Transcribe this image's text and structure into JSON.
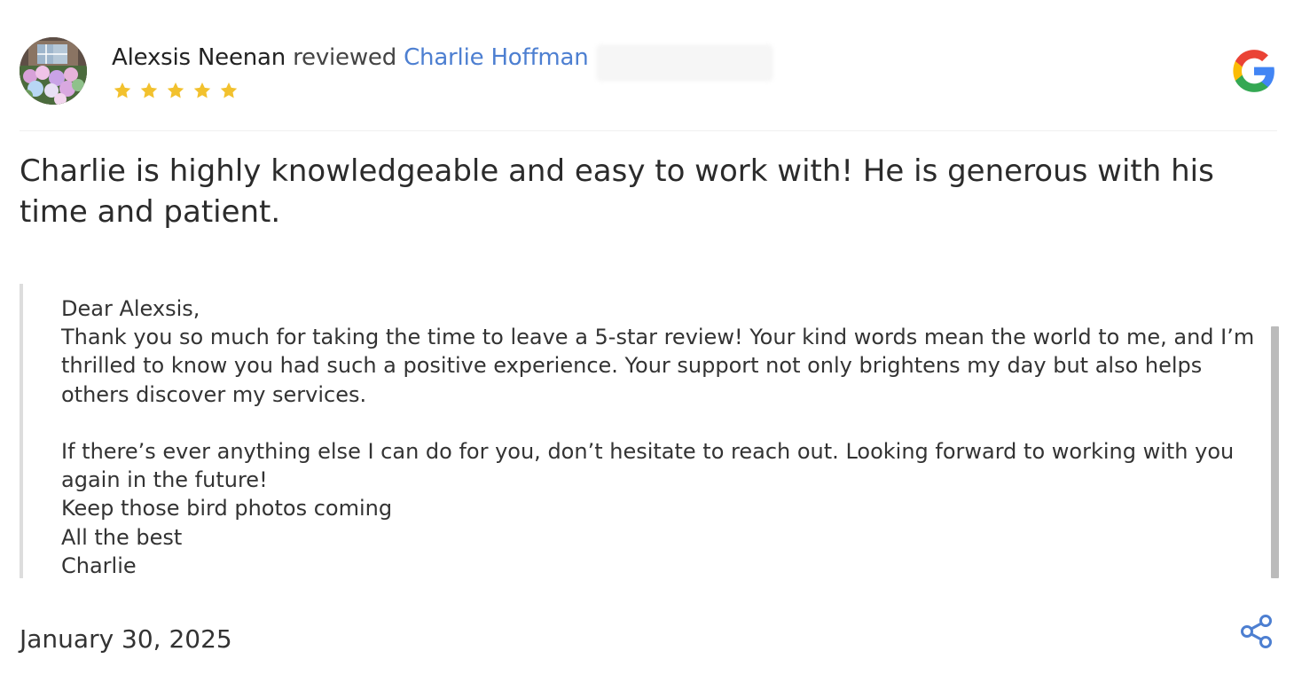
{
  "review": {
    "reviewer_name": "Alexsis Neenan",
    "reviewed_word": "reviewed",
    "reviewed_name": "Charlie Hoffman",
    "rating": 5,
    "text": "Charlie is highly knowledgeable and easy to work with! He is generous with his time and patient.",
    "date": "January 30, 2025",
    "source": "Google"
  },
  "reply": {
    "text": "Dear Alexsis,\nThank you so much for taking the time to leave a 5-star review! Your kind words mean the world to me, and I’m thrilled to know you had such a positive experience. Your support not only brightens my day but also helps others discover my services.\n\nIf there’s ever anything else I can do for you, don’t hesitate to reach out. Looking forward to working with you again in the future!\nKeep those bird photos coming\nAll the best\nCharlie"
  },
  "colors": {
    "link_blue": "#4d7fd1",
    "star_gold": "#f2c12e",
    "google_blue": "#4285F4",
    "google_red": "#EA4335",
    "google_yellow": "#FBBC05",
    "google_green": "#34A853"
  },
  "icons": {
    "stars": "star-icon",
    "google": "google-icon",
    "share": "share-icon"
  }
}
